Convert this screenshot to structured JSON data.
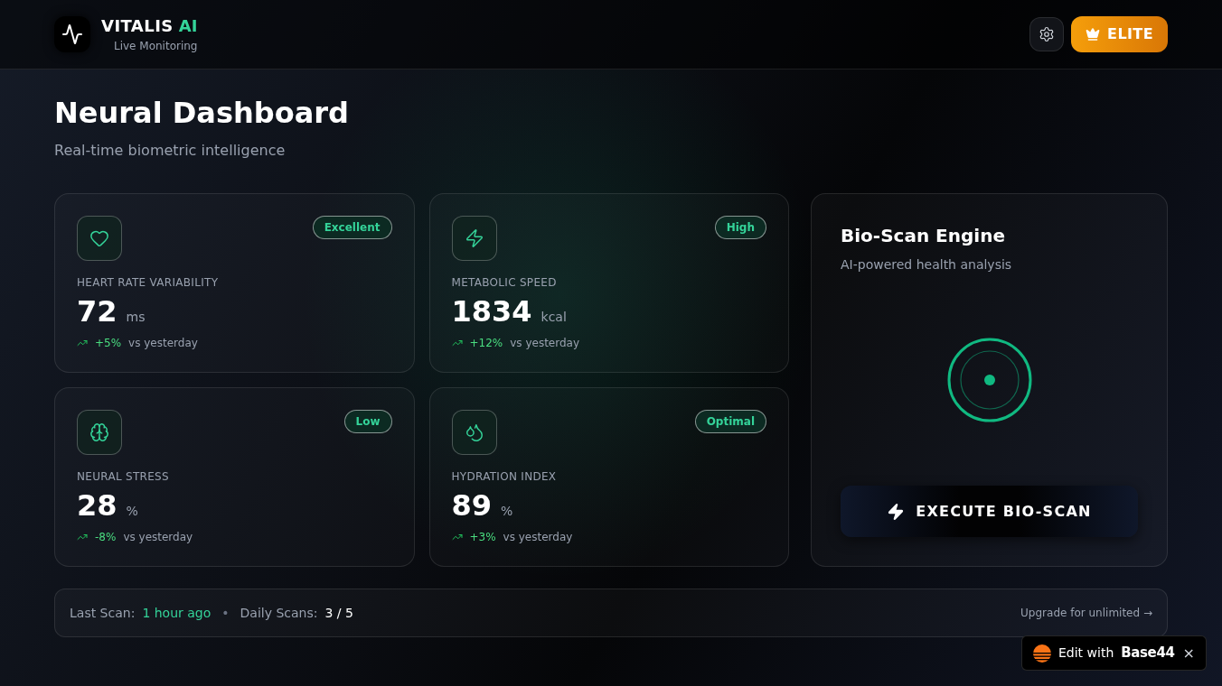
{
  "header": {
    "brand": {
      "name": "VITALIS",
      "accent": "AI"
    },
    "subtitle": "Live Monitoring",
    "plan_button": "ELITE"
  },
  "page": {
    "title": "Neural Dashboard",
    "subtitle": "Real-time biometric intelligence"
  },
  "metrics": [
    {
      "badge": "Excellent",
      "label": "HEART RATE VARIABILITY",
      "value": "72",
      "unit": "ms",
      "change": "+5%",
      "comparison": "vs yesterday"
    },
    {
      "badge": "High",
      "label": "METABOLIC SPEED",
      "value": "1834",
      "unit": "kcal",
      "change": "+12%",
      "comparison": "vs yesterday"
    },
    {
      "badge": "Low",
      "label": "NEURAL STRESS",
      "value": "28",
      "unit": "%",
      "change": "-8%",
      "comparison": "vs yesterday"
    },
    {
      "badge": "Optimal",
      "label": "HYDRATION INDEX",
      "value": "89",
      "unit": "%",
      "change": "+3%",
      "comparison": "vs yesterday"
    }
  ],
  "scan_panel": {
    "title": "Bio-Scan Engine",
    "subtitle": "AI-powered health analysis",
    "button": "EXECUTE BIO-SCAN"
  },
  "status_bar": {
    "items": [
      {
        "label": "Last Scan:",
        "value": "1 hour ago"
      },
      {
        "label": "Daily Scans:",
        "value": "3 / 5"
      }
    ],
    "separator": "•",
    "link": "Upgrade for unlimited →"
  },
  "edit_badge": {
    "text": "Edit with",
    "brand": "Base44",
    "close": "×"
  }
}
